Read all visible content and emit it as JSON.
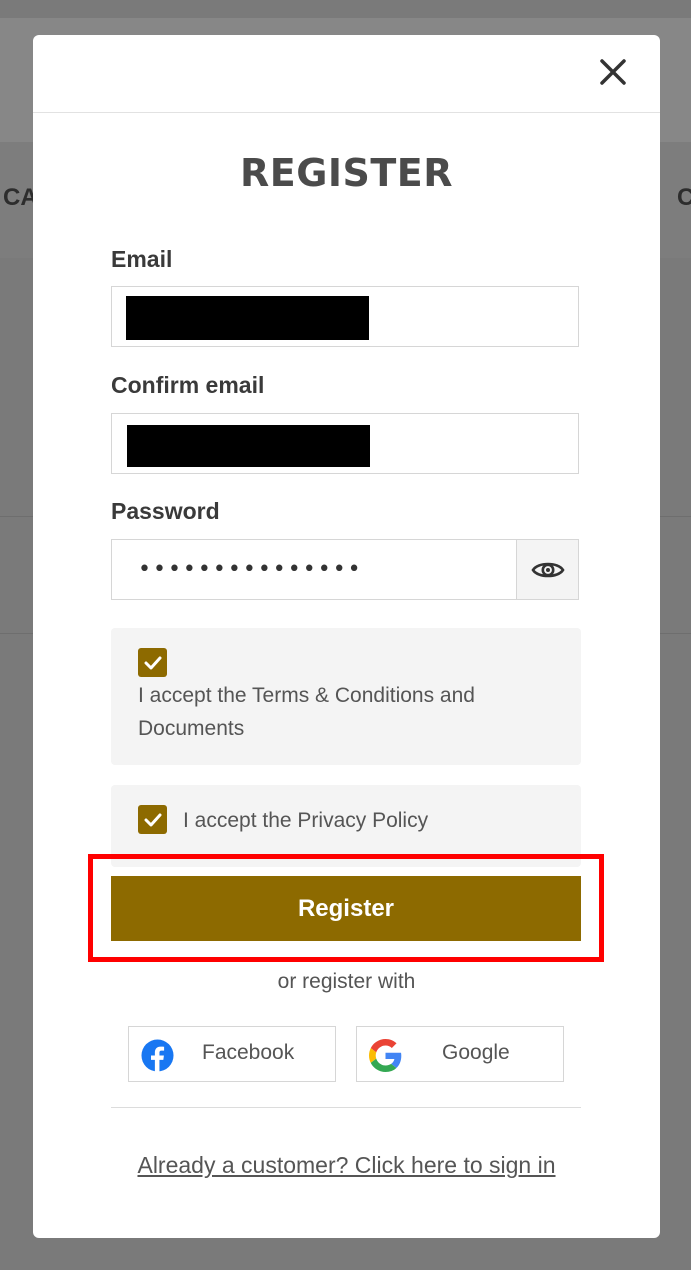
{
  "background": {
    "nav_left_text": "CA",
    "nav_right_text": "C"
  },
  "modal": {
    "close_icon": "close-icon",
    "title": "REGISTER",
    "email": {
      "label": "Email",
      "value": "[redacted]"
    },
    "confirm_email": {
      "label": "Confirm email",
      "value": "[redacted]"
    },
    "password": {
      "label": "Password",
      "value": "•••••••••••••••",
      "toggle_icon": "eye-icon"
    },
    "terms": {
      "checked": true,
      "text": "I accept the Terms & Conditions and Documents"
    },
    "privacy": {
      "checked": true,
      "text": "I accept the Privacy Policy"
    },
    "register_label": "Register",
    "or_text": "or register with",
    "social": {
      "facebook": {
        "label": "Facebook",
        "icon": "facebook-icon"
      },
      "google": {
        "label": "Google",
        "icon": "google-icon"
      }
    },
    "signin_link": "Already a customer? Click here to sign in"
  },
  "colors": {
    "accent": "#8d6a00",
    "highlight": "#ff0000",
    "overlay": "#7a7a7a"
  }
}
